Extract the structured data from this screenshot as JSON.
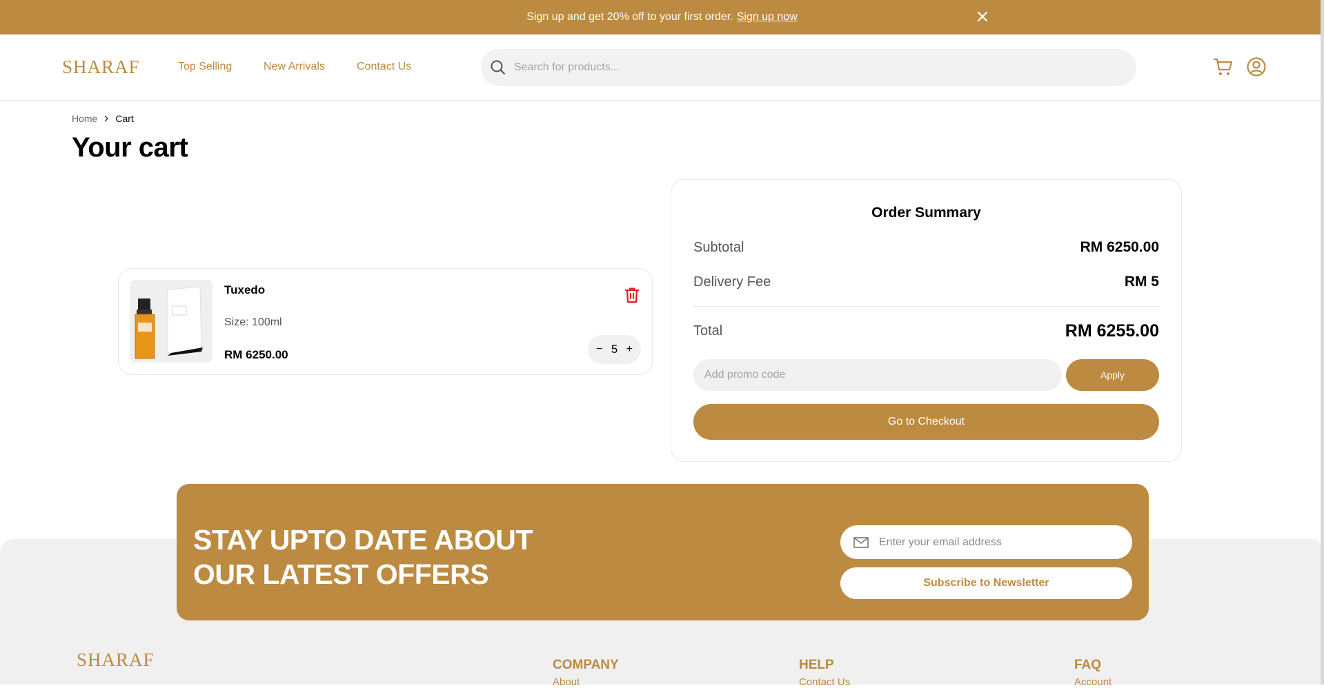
{
  "promo": {
    "text": "Sign up and get 20% off to your first order.",
    "link": "Sign up now"
  },
  "header": {
    "logo": "SHARAF",
    "nav": [
      "Top Selling",
      "New Arrivals",
      "Contact Us"
    ],
    "search_placeholder": "Search for products..."
  },
  "breadcrumb": {
    "home": "Home",
    "current": "Cart"
  },
  "page_title": "Your cart",
  "cart_items": [
    {
      "name": "Tuxedo",
      "size": "Size: 100ml",
      "price": "RM 6250.00",
      "quantity": "5",
      "minus": "−",
      "plus": "+"
    }
  ],
  "summary": {
    "title": "Order Summary",
    "subtotal_label": "Subtotal",
    "subtotal_value": "RM 6250.00",
    "delivery_label": "Delivery Fee",
    "delivery_value": "RM 5",
    "total_label": "Total",
    "total_value": "RM 6255.00",
    "promo_placeholder": "Add promo code",
    "apply_label": "Apply",
    "checkout_label": "Go to Checkout"
  },
  "newsletter": {
    "title_line1": "STAY UPTO DATE ABOUT",
    "title_line2": "OUR LATEST OFFERS",
    "email_placeholder": "Enter your email address",
    "subscribe_label": "Subscribe to Newsletter"
  },
  "footer": {
    "logo": "SHARAF",
    "columns": [
      {
        "title": "COMPANY",
        "first_link": "About"
      },
      {
        "title": "HELP",
        "first_link": "Contact Us"
      },
      {
        "title": "FAQ",
        "first_link": "Account"
      }
    ]
  },
  "colors": {
    "brand": "#BC8A40",
    "delete": "#e11d1d"
  }
}
